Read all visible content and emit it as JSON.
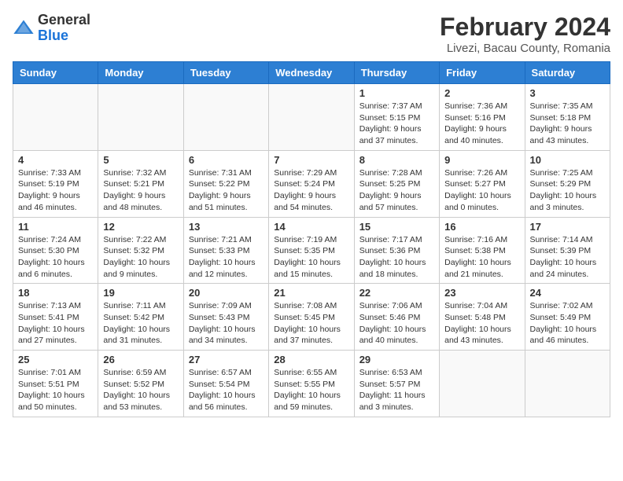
{
  "logo": {
    "general": "General",
    "blue": "Blue"
  },
  "title": "February 2024",
  "subtitle": "Livezi, Bacau County, Romania",
  "days_of_week": [
    "Sunday",
    "Monday",
    "Tuesday",
    "Wednesday",
    "Thursday",
    "Friday",
    "Saturday"
  ],
  "weeks": [
    [
      {
        "day": "",
        "info": ""
      },
      {
        "day": "",
        "info": ""
      },
      {
        "day": "",
        "info": ""
      },
      {
        "day": "",
        "info": ""
      },
      {
        "day": "1",
        "info": "Sunrise: 7:37 AM\nSunset: 5:15 PM\nDaylight: 9 hours\nand 37 minutes."
      },
      {
        "day": "2",
        "info": "Sunrise: 7:36 AM\nSunset: 5:16 PM\nDaylight: 9 hours\nand 40 minutes."
      },
      {
        "day": "3",
        "info": "Sunrise: 7:35 AM\nSunset: 5:18 PM\nDaylight: 9 hours\nand 43 minutes."
      }
    ],
    [
      {
        "day": "4",
        "info": "Sunrise: 7:33 AM\nSunset: 5:19 PM\nDaylight: 9 hours\nand 46 minutes."
      },
      {
        "day": "5",
        "info": "Sunrise: 7:32 AM\nSunset: 5:21 PM\nDaylight: 9 hours\nand 48 minutes."
      },
      {
        "day": "6",
        "info": "Sunrise: 7:31 AM\nSunset: 5:22 PM\nDaylight: 9 hours\nand 51 minutes."
      },
      {
        "day": "7",
        "info": "Sunrise: 7:29 AM\nSunset: 5:24 PM\nDaylight: 9 hours\nand 54 minutes."
      },
      {
        "day": "8",
        "info": "Sunrise: 7:28 AM\nSunset: 5:25 PM\nDaylight: 9 hours\nand 57 minutes."
      },
      {
        "day": "9",
        "info": "Sunrise: 7:26 AM\nSunset: 5:27 PM\nDaylight: 10 hours\nand 0 minutes."
      },
      {
        "day": "10",
        "info": "Sunrise: 7:25 AM\nSunset: 5:29 PM\nDaylight: 10 hours\nand 3 minutes."
      }
    ],
    [
      {
        "day": "11",
        "info": "Sunrise: 7:24 AM\nSunset: 5:30 PM\nDaylight: 10 hours\nand 6 minutes."
      },
      {
        "day": "12",
        "info": "Sunrise: 7:22 AM\nSunset: 5:32 PM\nDaylight: 10 hours\nand 9 minutes."
      },
      {
        "day": "13",
        "info": "Sunrise: 7:21 AM\nSunset: 5:33 PM\nDaylight: 10 hours\nand 12 minutes."
      },
      {
        "day": "14",
        "info": "Sunrise: 7:19 AM\nSunset: 5:35 PM\nDaylight: 10 hours\nand 15 minutes."
      },
      {
        "day": "15",
        "info": "Sunrise: 7:17 AM\nSunset: 5:36 PM\nDaylight: 10 hours\nand 18 minutes."
      },
      {
        "day": "16",
        "info": "Sunrise: 7:16 AM\nSunset: 5:38 PM\nDaylight: 10 hours\nand 21 minutes."
      },
      {
        "day": "17",
        "info": "Sunrise: 7:14 AM\nSunset: 5:39 PM\nDaylight: 10 hours\nand 24 minutes."
      }
    ],
    [
      {
        "day": "18",
        "info": "Sunrise: 7:13 AM\nSunset: 5:41 PM\nDaylight: 10 hours\nand 27 minutes."
      },
      {
        "day": "19",
        "info": "Sunrise: 7:11 AM\nSunset: 5:42 PM\nDaylight: 10 hours\nand 31 minutes."
      },
      {
        "day": "20",
        "info": "Sunrise: 7:09 AM\nSunset: 5:43 PM\nDaylight: 10 hours\nand 34 minutes."
      },
      {
        "day": "21",
        "info": "Sunrise: 7:08 AM\nSunset: 5:45 PM\nDaylight: 10 hours\nand 37 minutes."
      },
      {
        "day": "22",
        "info": "Sunrise: 7:06 AM\nSunset: 5:46 PM\nDaylight: 10 hours\nand 40 minutes."
      },
      {
        "day": "23",
        "info": "Sunrise: 7:04 AM\nSunset: 5:48 PM\nDaylight: 10 hours\nand 43 minutes."
      },
      {
        "day": "24",
        "info": "Sunrise: 7:02 AM\nSunset: 5:49 PM\nDaylight: 10 hours\nand 46 minutes."
      }
    ],
    [
      {
        "day": "25",
        "info": "Sunrise: 7:01 AM\nSunset: 5:51 PM\nDaylight: 10 hours\nand 50 minutes."
      },
      {
        "day": "26",
        "info": "Sunrise: 6:59 AM\nSunset: 5:52 PM\nDaylight: 10 hours\nand 53 minutes."
      },
      {
        "day": "27",
        "info": "Sunrise: 6:57 AM\nSunset: 5:54 PM\nDaylight: 10 hours\nand 56 minutes."
      },
      {
        "day": "28",
        "info": "Sunrise: 6:55 AM\nSunset: 5:55 PM\nDaylight: 10 hours\nand 59 minutes."
      },
      {
        "day": "29",
        "info": "Sunrise: 6:53 AM\nSunset: 5:57 PM\nDaylight: 11 hours\nand 3 minutes."
      },
      {
        "day": "",
        "info": ""
      },
      {
        "day": "",
        "info": ""
      }
    ]
  ]
}
